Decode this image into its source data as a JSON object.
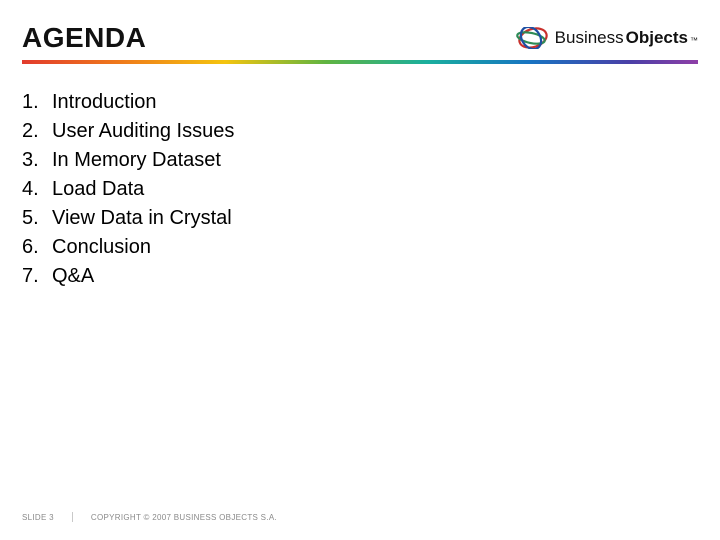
{
  "header": {
    "title": "AGENDA",
    "logo": {
      "text_light": "Business",
      "text_bold": "Objects",
      "tm": "™"
    }
  },
  "agenda": [
    {
      "num": "1.",
      "text": "Introduction"
    },
    {
      "num": "2.",
      "text": "User Auditing Issues"
    },
    {
      "num": "3.",
      "text": "In Memory Dataset"
    },
    {
      "num": "4.",
      "text": "Load Data"
    },
    {
      "num": "5.",
      "text": "View Data in Crystal"
    },
    {
      "num": "6.",
      "text": "Conclusion"
    },
    {
      "num": "7.",
      "text": "Q&A"
    }
  ],
  "footer": {
    "slide_label": "SLIDE 3",
    "copyright": "COPYRIGHT © 2007 BUSINESS OBJECTS S.A."
  }
}
